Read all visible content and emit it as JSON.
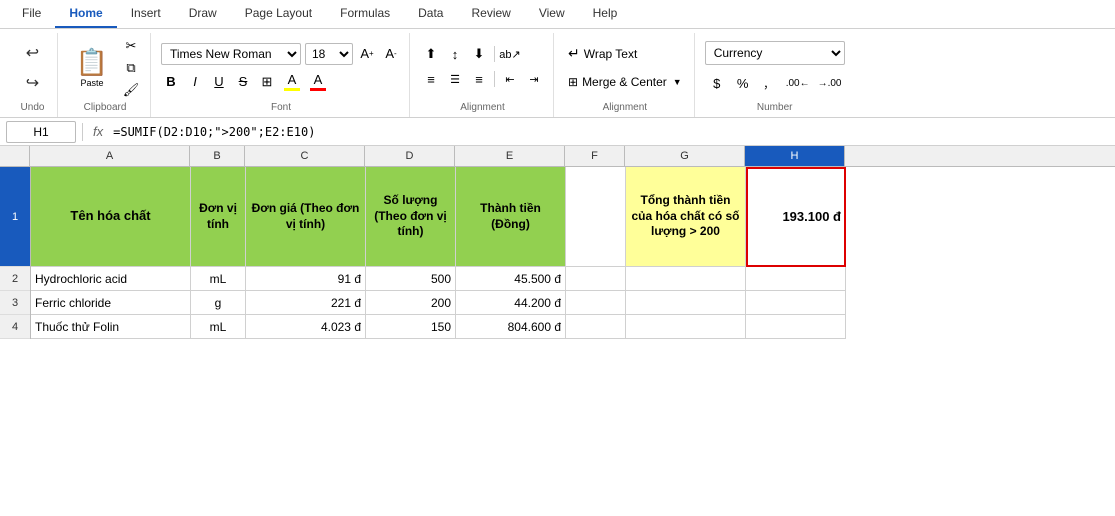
{
  "ribbon": {
    "tabs": [
      "File",
      "Home",
      "Insert",
      "Draw",
      "Page Layout",
      "Formulas",
      "Data",
      "Review",
      "View",
      "Help"
    ],
    "active_tab": "Home",
    "font_name": "Times New Roman",
    "font_size": "18",
    "wrap_text": "Wrap Text",
    "merge_center": "Merge & Center",
    "number_format": "Currency",
    "alignment_label": "Alignment",
    "font_label": "Font",
    "clipboard_label": "Clipboard",
    "number_label": "Number",
    "paste_label": "Paste"
  },
  "formula_bar": {
    "cell_ref": "H1",
    "fx": "fx",
    "formula": "=SUMIF(D2:D10;\">200\";E2:E10)"
  },
  "columns": {
    "headers": [
      "A",
      "B",
      "C",
      "D",
      "E",
      "F",
      "G",
      "H"
    ],
    "widths": [
      160,
      55,
      120,
      90,
      110,
      60,
      120,
      100
    ]
  },
  "rows": {
    "header_labels": [
      "",
      "1",
      "2",
      "3",
      "4"
    ],
    "header1_a": "Tên hóa chất",
    "header1_b": "Đơn vị tính",
    "header1_c": "Đơn giá (Theo đơn vị tính)",
    "header1_d": "Số lượng (Theo đơn vị tính)",
    "header1_e": "Thành tiền (Đồng)",
    "header1_f": "",
    "header1_g": "Tổng thành tiền của hóa chất có số lượng > 200",
    "header1_h": "193.100 đ",
    "row2_a": "Hydrochloric acid",
    "row2_b": "mL",
    "row2_c": "91 đ",
    "row2_d": "500",
    "row2_e": "45.500 đ",
    "row3_a": "Ferric chloride",
    "row3_b": "g",
    "row3_c": "221 đ",
    "row3_d": "200",
    "row3_e": "44.200 đ",
    "row4_a": "Thuốc thử Folin",
    "row4_b": "mL",
    "row4_c": "4.023 đ",
    "row4_d": "150",
    "row4_e": "804.600 đ"
  }
}
